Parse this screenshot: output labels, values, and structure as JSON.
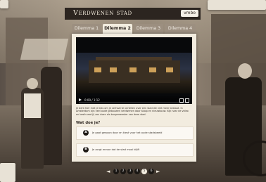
{
  "header": {
    "logo_text": "Verdwenen stad",
    "level_button": "vmbo"
  },
  "tabs": [
    {
      "label": "Dilemma 1",
      "active": false
    },
    {
      "label": "Dilemma 2",
      "active": true
    },
    {
      "label": "Dilemma 3",
      "active": false
    },
    {
      "label": "Dilemma 4",
      "active": false
    }
  ],
  "video": {
    "time_display": "0:00 / 1:12"
  },
  "content": {
    "description": "Je bent hier met je klas om je verhaal te vertellen over een stad die niet meer bestaat. In Amsterdam zijn veel oude gebouwen verdwenen door sloop en nieuwbouw. Kijk naar de video en beslis wat jij zou doen als burgemeester van deze stad.",
    "question": "Wat doe je?",
    "options": [
      {
        "letter": "A",
        "text": "Je gaat gewoon door en kiest voor het oude stadsbeeld"
      },
      {
        "letter": "B",
        "text": "Je zorgt ervoor dat de stad mooi blijft"
      }
    ]
  },
  "pager": {
    "prev": "◄",
    "next": "►",
    "pages": [
      "1",
      "2",
      "3",
      "4",
      "5",
      "6"
    ],
    "active_index": 4
  },
  "colors": {
    "panel_bg": "#f2ecdf",
    "tab_inactive": "#9c8f80",
    "topbar": "#2c2520",
    "dark_circle": "#1f1a16"
  }
}
